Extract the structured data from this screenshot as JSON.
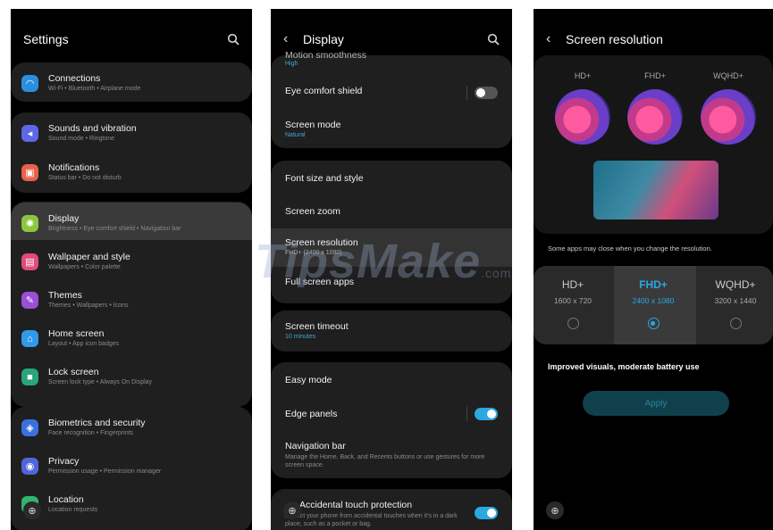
{
  "watermark": {
    "brand": "TipsMake",
    "domain": ".com"
  },
  "panel1": {
    "title": "Settings",
    "items": [
      {
        "title": "Connections",
        "sub": "Wi-Fi  •  Bluetooth  •  Airplane mode",
        "color": "#2b8fe0",
        "icon": "wifi-icon",
        "glyph": "◠"
      },
      {
        "title": "Sounds and vibration",
        "sub": "Sound mode  •  Ringtone",
        "color": "#5c68e6",
        "icon": "speaker-icon",
        "glyph": "◂"
      },
      {
        "title": "Notifications",
        "sub": "Status bar  •  Do not disturb",
        "color": "#e8614b",
        "icon": "bell-icon",
        "glyph": "▣"
      },
      {
        "title": "Display",
        "sub": "Brightness  •  Eye comfort shield  •  Navigation bar",
        "color": "#8cc63e",
        "icon": "sun-icon",
        "glyph": "✺"
      },
      {
        "title": "Wallpaper and style",
        "sub": "Wallpapers  •  Color palette",
        "color": "#e04b7a",
        "icon": "image-icon",
        "glyph": "▤"
      },
      {
        "title": "Themes",
        "sub": "Themes  •  Wallpapers  •  Icons",
        "color": "#9a4fd6",
        "icon": "brush-icon",
        "glyph": "✎"
      },
      {
        "title": "Home screen",
        "sub": "Layout  •  App icon badges",
        "color": "#2f9ae8",
        "icon": "home-icon",
        "glyph": "⌂"
      },
      {
        "title": "Lock screen",
        "sub": "Screen lock type  •  Always On Display",
        "color": "#2aa57a",
        "icon": "lock-icon",
        "glyph": "■"
      },
      {
        "title": "Biometrics and security",
        "sub": "Face recognition  •  Fingerprints",
        "color": "#3a6fe0",
        "icon": "shield-icon",
        "glyph": "◈"
      },
      {
        "title": "Privacy",
        "sub": "Permission usage  •  Permission manager",
        "color": "#5164d9",
        "icon": "privacy-icon",
        "glyph": "◉"
      },
      {
        "title": "Location",
        "sub": "Location requests",
        "color": "#34b36b",
        "icon": "location-icon",
        "glyph": "●"
      }
    ]
  },
  "panel2": {
    "title": "Display",
    "top_partial": {
      "title": "Motion smoothness",
      "sub": "High"
    },
    "eye_comfort": "Eye comfort shield",
    "screen_mode": {
      "title": "Screen mode",
      "sub": "Natural"
    },
    "font_size": "Font size and style",
    "screen_zoom": "Screen zoom",
    "screen_resolution": {
      "title": "Screen resolution",
      "sub": "FHD+ (2400 x 1080)"
    },
    "full_screen": "Full screen apps",
    "screen_timeout": {
      "title": "Screen timeout",
      "sub": "10 minutes"
    },
    "easy_mode": "Easy mode",
    "edge_panels": "Edge panels",
    "navigation_bar": {
      "title": "Navigation bar",
      "sub": "Manage the Home, Back, and Recents buttons or use gestures for more screen space."
    },
    "accidental": {
      "title": "Accidental touch protection",
      "sub": "Protect your phone from accidental touches when it's in a dark place, such as a pocket or bag."
    }
  },
  "panel3": {
    "title": "Screen resolution",
    "previews": [
      "HD+",
      "FHD+",
      "WQHD+"
    ],
    "note": "Some apps may close when you change the resolution.",
    "options": [
      {
        "name": "HD+",
        "res": "1600 x 720",
        "selected": false
      },
      {
        "name": "FHD+",
        "res": "2400 x 1080",
        "selected": true
      },
      {
        "name": "WQHD+",
        "res": "3200 x 1440",
        "selected": false
      }
    ],
    "desc": "Improved visuals, moderate battery use",
    "apply": "Apply"
  }
}
